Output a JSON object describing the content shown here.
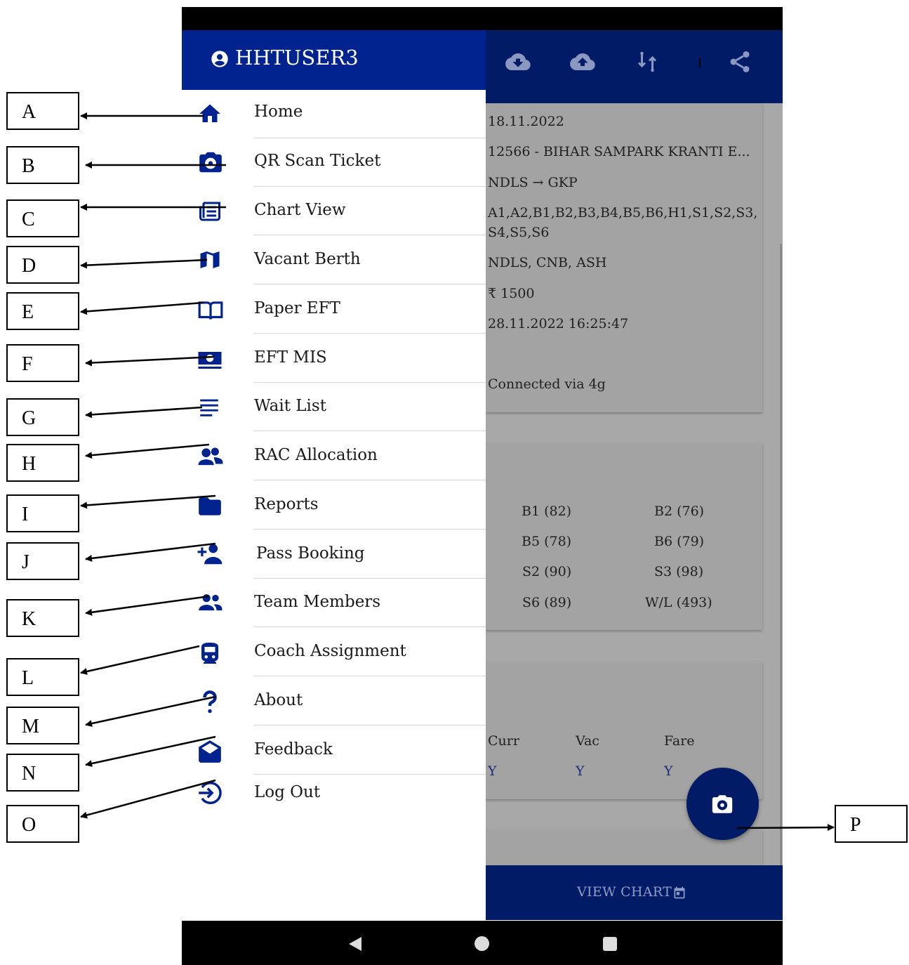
{
  "drawer": {
    "username": "HHTUSER3",
    "menu": [
      {
        "label": "Home",
        "icon": "home-icon"
      },
      {
        "label": "QR Scan Ticket",
        "icon": "camera-icon"
      },
      {
        "label": "Chart View",
        "icon": "newspaper-icon"
      },
      {
        "label": "Vacant Berth",
        "icon": "map-icon"
      },
      {
        "label": "Paper EFT",
        "icon": "book-open-icon"
      },
      {
        "label": "EFT MIS",
        "icon": "money-icon"
      },
      {
        "label": "Wait List",
        "icon": "list-lines-icon"
      },
      {
        "label": "RAC Allocation",
        "icon": "user-group-icon"
      },
      {
        "label": "Reports",
        "icon": "folder-icon"
      },
      {
        "label": "Pass Booking",
        "icon": "add-user-icon"
      },
      {
        "label": "Team Members",
        "icon": "people-icon"
      },
      {
        "label": "Coach Assignment",
        "icon": "train-icon"
      },
      {
        "label": "About",
        "icon": "question-icon"
      },
      {
        "label": "Feedback",
        "icon": "mail-open-icon"
      },
      {
        "label": "Log Out",
        "icon": "logout-icon"
      }
    ]
  },
  "toolbar": {
    "icons": [
      "cloud-download-icon",
      "cloud-upload-icon",
      "sync-icon",
      "share-icon"
    ]
  },
  "journey": {
    "date": "18.11.2022",
    "train": "12566 - BIHAR SAMPARK KRANTI E...",
    "route": "NDLS → GKP",
    "coaches_line1": "A1,A2,B1,B2,B3,B4,B5,B6,H1,S1,S2,S3,",
    "coaches_line2": "S4,S5,S6",
    "stations": "NDLS, CNB, ASH",
    "amount": "₹ 1500",
    "timestamp": "28.11.2022 16:25:47",
    "connection": "Connected via 4g"
  },
  "coach_counts": [
    "B1 (82)",
    "B2 (76)",
    "B5 (78)",
    "B6 (79)",
    "S2 (90)",
    "S3 (98)",
    "S6 (89)",
    "W/L (493)"
  ],
  "status_table": {
    "headers": [
      "Curr",
      "Vac",
      "Fare"
    ],
    "values": [
      "Y",
      "Y",
      "Y"
    ]
  },
  "view_chart_label": "VIEW CHART",
  "callouts": [
    "A",
    "B",
    "C",
    "D",
    "E",
    "F",
    "G",
    "H",
    "I",
    "J",
    "K",
    "L",
    "M",
    "N",
    "O",
    "P"
  ],
  "colors": {
    "primary": "#00238f",
    "topbar": "#011b66",
    "overlay": "#a8a8a8"
  }
}
